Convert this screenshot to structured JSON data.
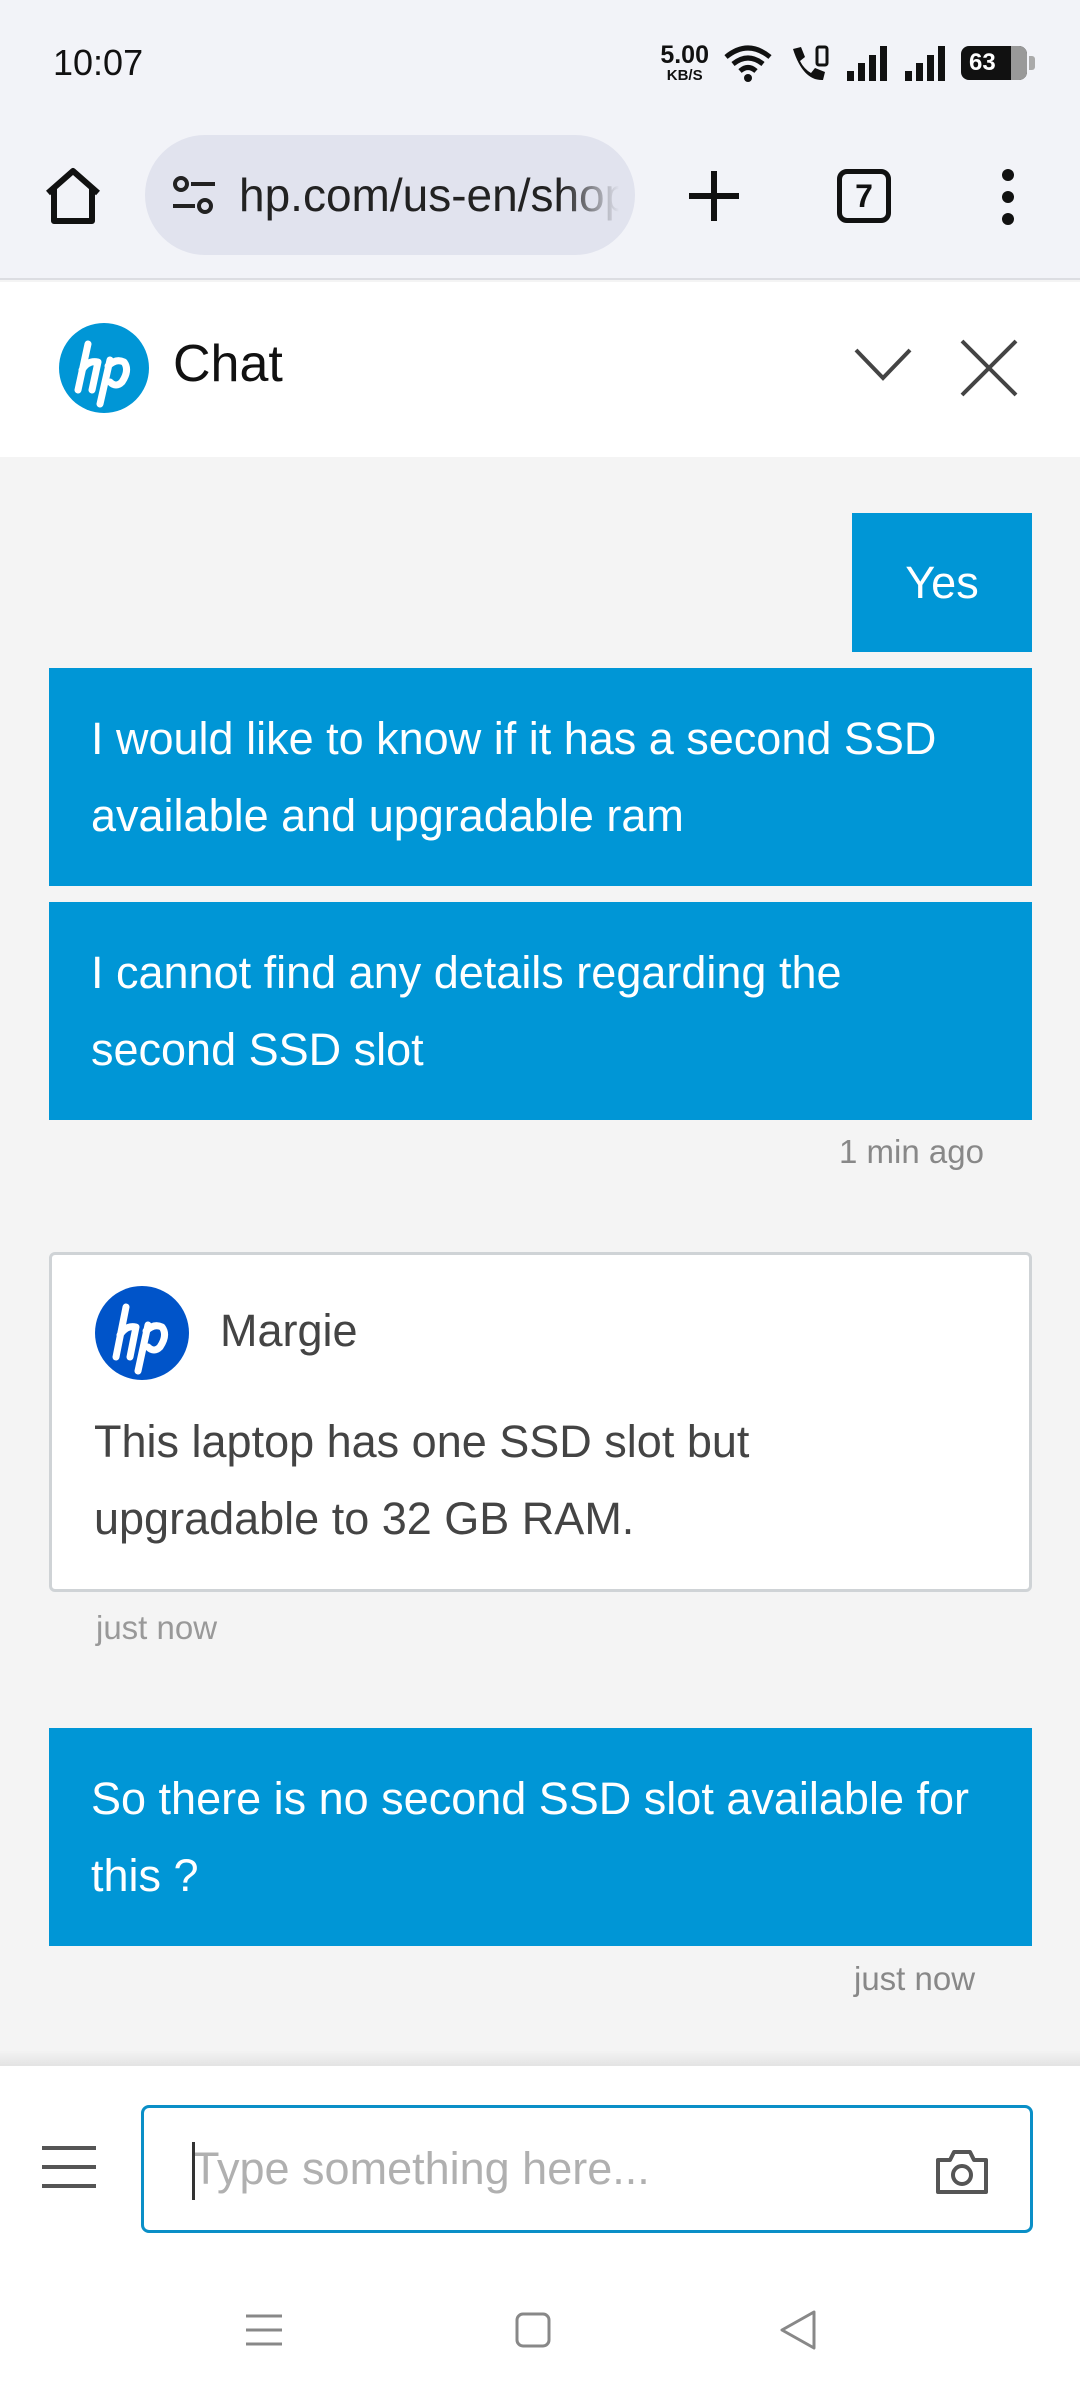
{
  "status_bar": {
    "time": "10:07",
    "speed_value": "5.00",
    "speed_unit": "KB/S",
    "battery": "63"
  },
  "browser": {
    "url": "hp.com/us-en/shop",
    "tab_count": "7"
  },
  "chat": {
    "title": "Chat",
    "messages": [
      {
        "sender": "user",
        "text": "Yes"
      },
      {
        "sender": "user",
        "text": "I would like to know if it has a second SSD available and upgradable ram"
      },
      {
        "sender": "user",
        "text": "I cannot find any details regarding the second SSD slot"
      },
      {
        "sender": "agent",
        "agent_name": "Margie",
        "text": "This laptop has one SSD slot but upgradable to 32 GB RAM."
      },
      {
        "sender": "user",
        "text": "So there is no second SSD slot available for this ?"
      }
    ],
    "timestamps": [
      "1 min ago",
      "just now",
      "just now"
    ]
  },
  "input": {
    "placeholder": "Type something here...",
    "value": ""
  },
  "colors": {
    "accent": "#0096d6",
    "hp_blue": "#0054c9",
    "input_border": "#0a8fc7"
  },
  "icons": {
    "home": "home-icon",
    "site_settings": "tune-icon",
    "new_tab": "plus-icon",
    "tabs": "tab-switcher-icon",
    "more": "more-vert-icon",
    "collapse": "chevron-down-icon",
    "close": "close-icon",
    "menu": "hamburger-icon",
    "camera": "camera-icon"
  }
}
